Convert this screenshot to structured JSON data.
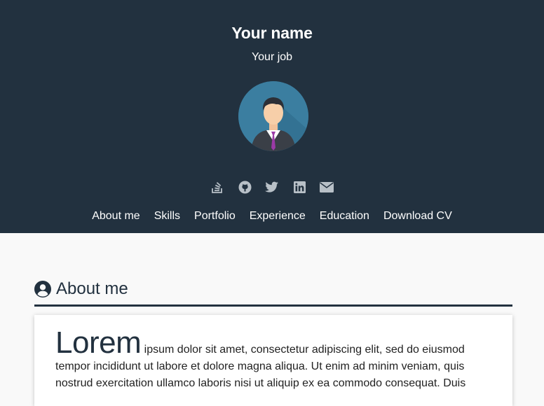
{
  "header": {
    "name": "Your name",
    "job": "Your job",
    "background": "#22313f"
  },
  "socials": [
    {
      "icon": "stackoverflow-icon"
    },
    {
      "icon": "github-icon"
    },
    {
      "icon": "twitter-icon"
    },
    {
      "icon": "linkedin-icon"
    },
    {
      "icon": "email-icon"
    }
  ],
  "nav": {
    "items": [
      "About me",
      "Skills",
      "Portfolio",
      "Experience",
      "Education",
      "Download CV"
    ]
  },
  "about": {
    "title": "About me",
    "icon": "user-circle-icon",
    "dropcap": "Lorem",
    "line1": " ipsum dolor sit amet, consectetur adipiscing elit, sed do eiusmod",
    "line2": "tempor incididunt ut labore et dolore magna aliqua. Ut enim ad minim veniam, quis",
    "line3": "nostrud exercitation ullamco laboris nisi ut aliquip ex ea commodo consequat. Duis"
  }
}
